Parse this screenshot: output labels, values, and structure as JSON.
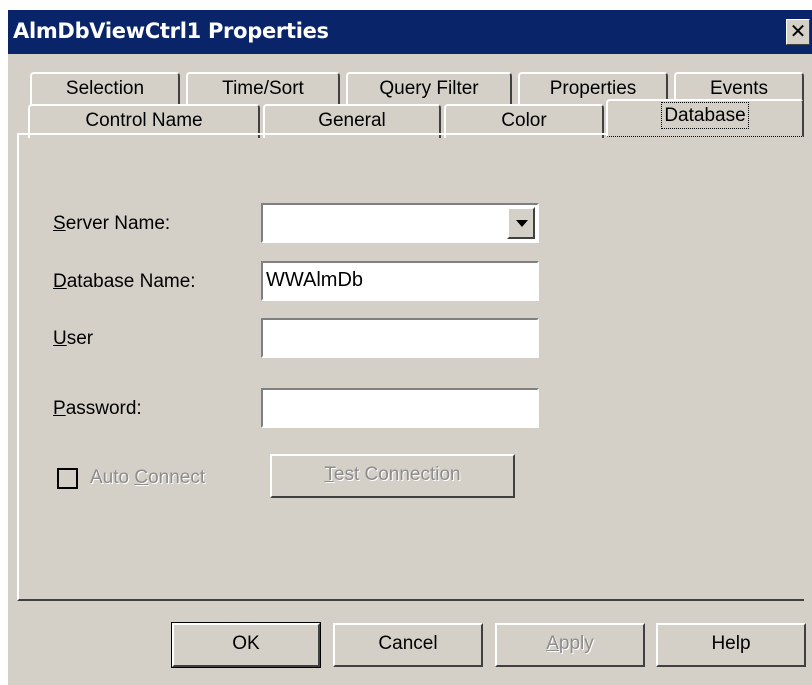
{
  "window": {
    "title": "AlmDbViewCtrl1 Properties",
    "close_label": "✕"
  },
  "tabs_row1": [
    {
      "label": "Selection"
    },
    {
      "label": "Time/Sort"
    },
    {
      "label": "Query Filter"
    },
    {
      "label": "Properties"
    },
    {
      "label": "Events"
    }
  ],
  "tabs_row2": [
    {
      "label": "Control Name"
    },
    {
      "label": "General"
    },
    {
      "label": "Color"
    },
    {
      "label": "Database"
    }
  ],
  "form": {
    "server_label_u": "S",
    "server_label_rest": "erver Name:",
    "server_value": "",
    "dbname_label_u": "D",
    "dbname_label_rest": "atabase Name:",
    "dbname_value": "WWAlmDb",
    "user_label_u": "U",
    "user_label_rest": "ser",
    "user_value": "",
    "password_label_u": "P",
    "password_label_rest": "assword:",
    "password_value": "",
    "autoconnect_label_a": "Auto ",
    "autoconnect_label_u": "C",
    "autoconnect_label_rest": "onnect",
    "testconn_u": "T",
    "testconn_rest": "est Connection"
  },
  "buttons": {
    "ok": "OK",
    "cancel": "Cancel",
    "apply_u": "A",
    "apply_rest": "pply",
    "help": "Help"
  }
}
